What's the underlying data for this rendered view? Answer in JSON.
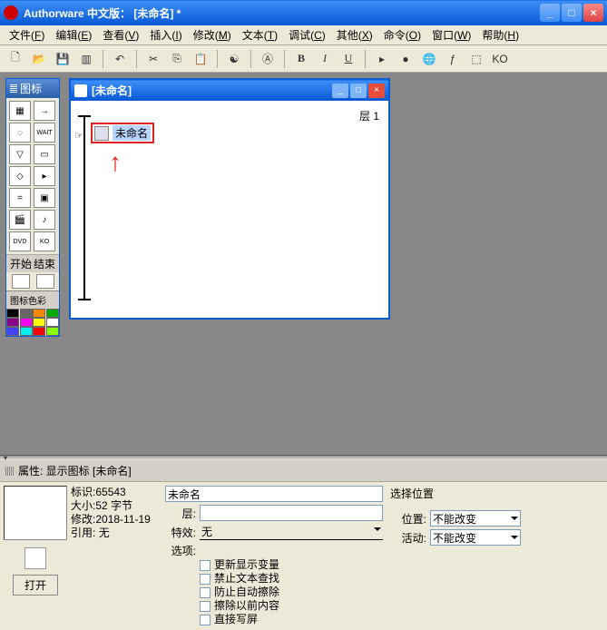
{
  "app": {
    "title": "Authorware 中文版： [未命名] *",
    "window_buttons": {
      "min": "_",
      "max": "□",
      "close": "×"
    }
  },
  "menus": [
    {
      "label": "文件",
      "key": "F"
    },
    {
      "label": "编辑",
      "key": "E"
    },
    {
      "label": "查看",
      "key": "V"
    },
    {
      "label": "插入",
      "key": "I"
    },
    {
      "label": "修改",
      "key": "M"
    },
    {
      "label": "文本",
      "key": "T"
    },
    {
      "label": "调试",
      "key": "C"
    },
    {
      "label": "其他",
      "key": "X"
    },
    {
      "label": "命令",
      "key": "O"
    },
    {
      "label": "窗口",
      "key": "W"
    },
    {
      "label": "帮助",
      "key": "H"
    }
  ],
  "toolbar_icons": [
    "new",
    "open",
    "save",
    "import",
    "|",
    "undo",
    "|",
    "cut",
    "copy",
    "paste",
    "|",
    "find",
    "|",
    "style",
    "|",
    "bold",
    "italic",
    "underline",
    "|",
    "play",
    "stop",
    "globe",
    "func",
    "var",
    "ko"
  ],
  "format_labels": {
    "bold": "B",
    "italic": "I",
    "underline": "U"
  },
  "icons_panel": {
    "title": "图标",
    "tools": [
      "display",
      "motion",
      "erase",
      "wait",
      "nav",
      "framework",
      "decision",
      "interaction",
      "calc",
      "map",
      "movie",
      "sound",
      "dvd",
      "ko"
    ],
    "start_end": {
      "start": "开始",
      "end": "结束"
    },
    "colors_label": "图标色彩",
    "palette": [
      "#000",
      "#666",
      "#f80",
      "#0a0",
      "#808",
      "#f0f",
      "#ff0",
      "#fff",
      "#44f",
      "#0ee",
      "#f00",
      "#8f0"
    ]
  },
  "design_window": {
    "title": "[未命名]",
    "layer_label": "层 1",
    "icon_label": "未命名"
  },
  "properties": {
    "panel_title": "属性: 显示图标 [未命名]",
    "meta": {
      "id_label": "标识:",
      "id": "65543",
      "size_label": "大小:",
      "size": "52 字节",
      "mod_label": "修改:",
      "mod": "2018-11-19",
      "ref_label": "引用:",
      "ref": "无"
    },
    "name_value": "未命名",
    "rows": {
      "layer": "层:",
      "layer_val": "",
      "effect": "特效:",
      "effect_val": "无",
      "options": "选项:"
    },
    "checks": [
      "更新显示变量",
      "禁止文本查找",
      "防止自动擦除",
      "擦除以前内容",
      "直接写屏"
    ],
    "pos_section": {
      "title": "选择位置",
      "position": "位置:",
      "position_val": "不能改变",
      "activity": "活动:",
      "activity_val": "不能改变"
    },
    "open_btn": "打开"
  }
}
